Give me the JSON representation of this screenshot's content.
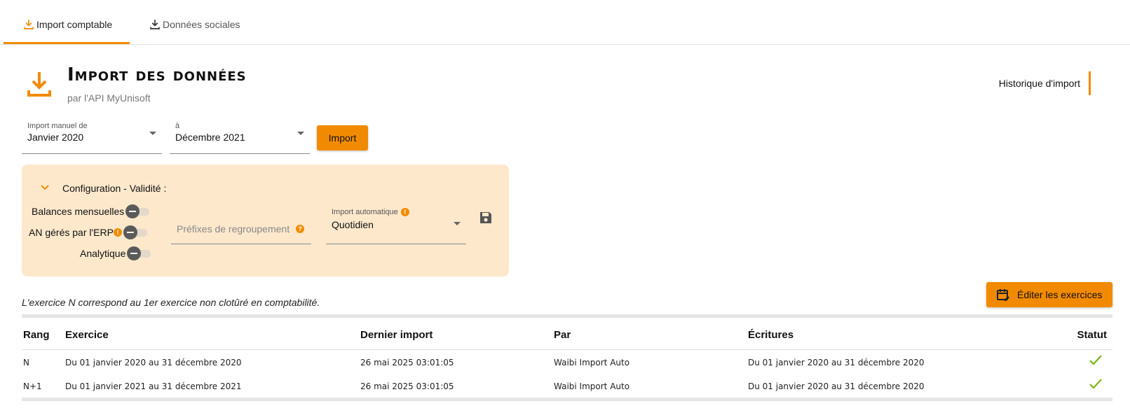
{
  "tabs": [
    {
      "label": "Import comptable",
      "icon": "download-icon",
      "active": true
    },
    {
      "label": "Données sociales",
      "icon": "download-icon",
      "active": false
    }
  ],
  "header": {
    "icon": "download-icon",
    "title": "Import des données",
    "subtitle": "par l'API MyUnisoft",
    "history_link": "Historique d'import"
  },
  "import_form": {
    "from": {
      "label": "Import manuel de",
      "value": "Janvier 2020"
    },
    "to": {
      "label": "à",
      "value": "Décembre 2021"
    },
    "button": "Import"
  },
  "config": {
    "title": "Configuration - Validité :",
    "toggles": [
      {
        "label": "Balances mensuelles",
        "on": false
      },
      {
        "label": "AN gérés par l'ERP",
        "on": false,
        "info": "!"
      },
      {
        "label": "Analytique",
        "on": false
      }
    ],
    "prefix_placeholder": "Préfixes de regroupement",
    "prefix_info": "?",
    "auto_import": {
      "label": "Import automatique",
      "value": "Quotidien",
      "info": "!"
    }
  },
  "note": "L'exercice N correspond au 1er exercice non clotûré en comptabilité.",
  "edit_button": "Éditer les exercices",
  "table": {
    "headers": [
      "Rang",
      "Exercice",
      "Dernier import",
      "Par",
      "Écritures",
      "Statut"
    ],
    "rows": [
      [
        "N",
        "Du 01 janvier 2020 au 31 décembre 2020",
        "26 mai 2025 03:01:05",
        "Waibi Import Auto",
        "Du 01 janvier 2020 au 31 décembre 2020"
      ],
      [
        "N+1",
        "Du 01 janvier 2021 au 31 décembre 2021",
        "26 mai 2025 03:01:05",
        "Waibi Import Auto",
        "Du 01 janvier 2020 au 31 décembre 2020"
      ]
    ],
    "status_icon": "check-icon"
  },
  "colors": {
    "accent": "#f28a00",
    "panel": "#fde8cc",
    "success": "#7cb518"
  }
}
